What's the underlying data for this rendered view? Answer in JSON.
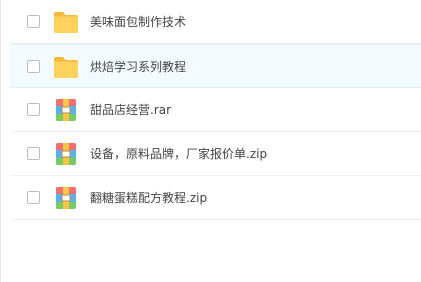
{
  "files": [
    {
      "name": "美味面包制作技术",
      "type": "folder",
      "icon": "folder-icon",
      "selected": false
    },
    {
      "name": "烘焙学习系列教程",
      "type": "folder",
      "icon": "folder-icon",
      "selected": true
    },
    {
      "name": "甜品店经营.rar",
      "type": "archive",
      "icon": "archive-icon",
      "selected": false
    },
    {
      "name": "设备，原料品牌，厂家报价单.zip",
      "type": "archive",
      "icon": "archive-icon",
      "selected": false
    },
    {
      "name": "翻糖蛋糕配方教程.zip",
      "type": "archive",
      "icon": "archive-icon",
      "selected": false
    }
  ],
  "colors": {
    "folder": "#FFC94A",
    "selected_row": "#F4FBFF",
    "text": "#444444"
  }
}
